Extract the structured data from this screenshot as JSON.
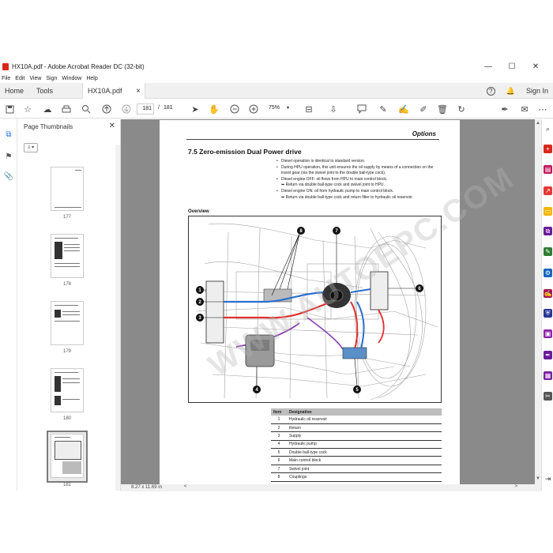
{
  "window": {
    "title": "HX10A.pdf - Adobe Acrobat Reader DC (32-bit)",
    "controls": {
      "minimize": "—",
      "maximize": "☐",
      "close": "✕"
    }
  },
  "menu": [
    "File",
    "Edit",
    "View",
    "Sign",
    "Window",
    "Help"
  ],
  "tabs": {
    "home": "Home",
    "tools": "Tools",
    "doc": "HX10A.pdf",
    "close": "×",
    "help": "?",
    "bell": "🔔",
    "signin": "Sign In"
  },
  "toolbar": {
    "page_current": "181",
    "page_sep": "/",
    "page_total": "181",
    "zoom": "75%"
  },
  "thumbnails": {
    "header": "Page Thumbnails",
    "close": "✕",
    "options": "≡ ▾",
    "pages": [
      "177",
      "178",
      "179",
      "180",
      "181"
    ]
  },
  "page": {
    "header": "Options",
    "section_title": "7.5   Zero-emission Dual Power drive",
    "bullets": [
      {
        "type": "b",
        "text": "Diesel operation is identical to standard version."
      },
      {
        "type": "b",
        "text": "During HPU operation, this unit ensures the oil supply by means of a connection on the"
      },
      {
        "type": "c",
        "text": "travel gear (via the swivel joint to the double ball-type cock)."
      },
      {
        "type": "b",
        "text": "Diesel engine OFF: oil flows from HPU to main control block."
      },
      {
        "type": "a",
        "text": "➥ Return via double ball-type cock and swivel joint to HPU."
      },
      {
        "type": "b",
        "text": "Diesel engine ON: oil from hydraulic pump to main control block."
      },
      {
        "type": "a",
        "text": "➥ Return via double ball-type cock and return filter to hydraulic oil reservoir."
      }
    ],
    "overview_label": "Overview",
    "watermark": "WWW.AUTOEPC.COM",
    "callouts": [
      "1",
      "2",
      "3",
      "4",
      "5",
      "6",
      "7",
      "8"
    ],
    "legend_headers": {
      "item": "Item",
      "designation": "Designation"
    },
    "legend": [
      {
        "item": "1",
        "designation": "Hydraulic oil reservoir"
      },
      {
        "item": "2",
        "designation": "Return"
      },
      {
        "item": "3",
        "designation": "Supply"
      },
      {
        "item": "4",
        "designation": "Hydraulic pump"
      },
      {
        "item": "5",
        "designation": "Double ball-type cock"
      },
      {
        "item": "6",
        "designation": "Main control block"
      },
      {
        "item": "7",
        "designation": "Swivel joint"
      },
      {
        "item": "8",
        "designation": "Couplings"
      }
    ]
  },
  "statusbar": {
    "size": "8.27 x 11.69 in",
    "left_arrow": "<",
    "right_arrow": ">"
  },
  "colors": {
    "accent": "#d9261c",
    "viewer_bg": "#8a8a8a",
    "supply_line": "#e03030",
    "return_line": "#2a6fd0"
  }
}
